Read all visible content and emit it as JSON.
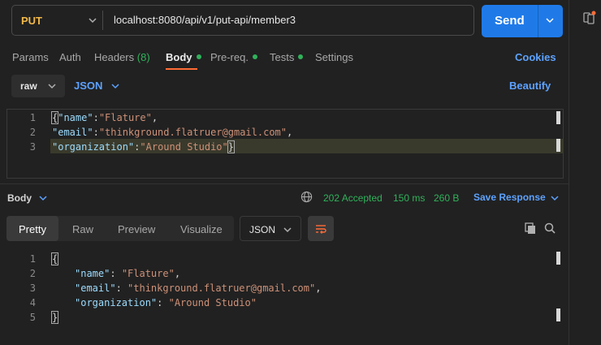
{
  "request": {
    "method": "PUT",
    "url": "localhost:8080/api/v1/put-api/member3",
    "send_label": "Send"
  },
  "tabs": [
    {
      "label": "Params"
    },
    {
      "label": "Auth"
    },
    {
      "label": "Headers",
      "count": "(8)"
    },
    {
      "label": "Body",
      "active": true
    },
    {
      "label": "Pre-req."
    },
    {
      "label": "Tests"
    },
    {
      "label": "Settings"
    }
  ],
  "cookies_label": "Cookies",
  "body_options": {
    "mode": "raw",
    "language": "JSON",
    "beautify_label": "Beautify"
  },
  "request_body": {
    "line_numbers": [
      "1",
      "2",
      "3"
    ],
    "lines": [
      {
        "key": "\"name\"",
        "value": "\"Flature\""
      },
      {
        "key": "\"email\"",
        "value": "\"thinkground.flatruer@gmail.com\""
      },
      {
        "key": "\"organization\"",
        "value": "\"Around Studio\""
      }
    ]
  },
  "response": {
    "section_label": "Body",
    "status": "202 Accepted",
    "time": "150 ms",
    "size": "260 B",
    "save_label": "Save Response",
    "view_tabs": [
      "Pretty",
      "Raw",
      "Preview",
      "Visualize"
    ],
    "format": "JSON",
    "line_numbers": [
      "1",
      "2",
      "3",
      "4",
      "5"
    ],
    "lines": [
      {
        "key": "\"name\"",
        "value": "\"Flature\""
      },
      {
        "key": "\"email\"",
        "value": "\"thinkground.flatruer@gmail.com\""
      },
      {
        "key": "\"organization\"",
        "value": "\"Around Studio\""
      }
    ]
  },
  "colors": {
    "accent": "#ff6c37",
    "send": "#1f7ae8",
    "method": "#f2b94a",
    "success": "#30b25b",
    "link": "#5da2ff"
  }
}
